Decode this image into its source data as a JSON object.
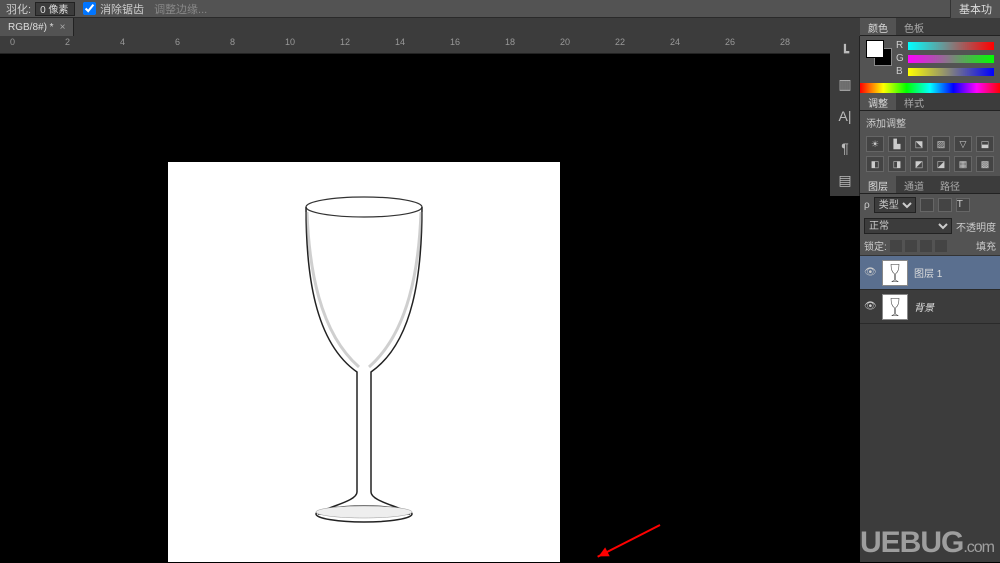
{
  "options": {
    "feather_label": "羽化:",
    "feather_value": "0 像素",
    "antialias_label": "消除锯齿",
    "refine_edge_label": "调整边缘..."
  },
  "top_right_button": "基本功",
  "tab": {
    "title": "RGB/8#) *",
    "close": "×"
  },
  "ruler_ticks": [
    0,
    2,
    4,
    6,
    8,
    10,
    12,
    14,
    16,
    18,
    20,
    22,
    24,
    26,
    28
  ],
  "panels": {
    "color": {
      "tab1": "颜色",
      "tab2": "色板",
      "channels": [
        "R",
        "G",
        "B"
      ]
    },
    "adjust": {
      "tab1": "调整",
      "tab2": "样式",
      "title": "添加调整"
    },
    "layers": {
      "tab1": "图层",
      "tab2": "通道",
      "tab3": "路径",
      "filter_label": "类型",
      "blend_mode": "正常",
      "opacity_label": "不透明度",
      "lock_label": "锁定:",
      "fill_label": "填充",
      "items": [
        {
          "name": "图层 1"
        },
        {
          "name": "背景"
        }
      ]
    }
  },
  "watermark": {
    "brand": "UEBUG",
    "suffix": ".com"
  }
}
